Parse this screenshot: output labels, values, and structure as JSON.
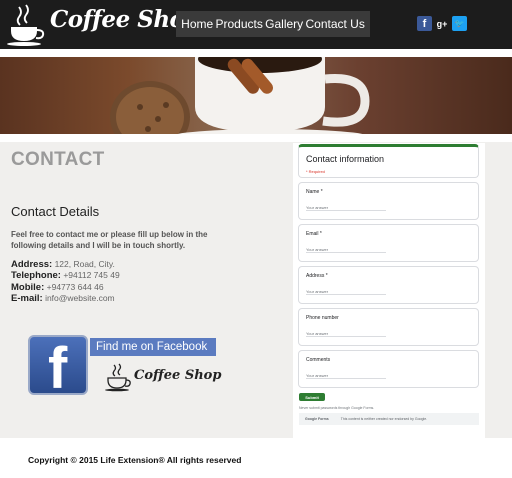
{
  "brand": {
    "name": "Coffee Shop"
  },
  "nav": {
    "home": "Home",
    "products": "Products",
    "gallery": "Gallery",
    "contact": "Contact Us"
  },
  "social": {
    "facebook_icon": "facebook-icon",
    "facebook_glyph": "f",
    "googleplus_icon": "googleplus-icon",
    "googleplus_glyph": "g+",
    "twitter_icon": "twitter-icon",
    "twitter_glyph": "🐦"
  },
  "page": {
    "title": "CONTACT",
    "details_heading": "Contact Details",
    "intro": "Feel free to contact me or please fill up below in the following details and I will be in touch shortly.",
    "address_label": "Address:",
    "address_value": "122, Road, City.",
    "telephone_label": "Telephone:",
    "telephone_value": "+94112 745 49",
    "mobile_label": "Mobile:",
    "mobile_value": "+94773 644 46",
    "email_label": "E-mail:",
    "email_value": "info@website.com",
    "facebook_banner": "Find me on Facebook",
    "facebook_glyph": "f",
    "footer_brand": "Coffee Shop"
  },
  "form": {
    "title": "Contact information",
    "required_note": "* Required",
    "fields": [
      {
        "label": "Name *",
        "placeholder": "Your answer"
      },
      {
        "label": "Email *",
        "placeholder": "Your answer"
      },
      {
        "label": "Address *",
        "placeholder": "Your answer"
      },
      {
        "label": "Phone number",
        "placeholder": "Your answer"
      },
      {
        "label": "Comments",
        "placeholder": "Your answer"
      }
    ],
    "submit": "Submit",
    "never_submit": "Never submit passwords through Google Forms.",
    "footer_brand": "Google Forms",
    "footer_note": "This content is neither created nor endorsed by Google."
  },
  "footer": {
    "copyright": "Copyright © 2015 Life Extension® All rights reserved"
  },
  "colors": {
    "header_bg": "#1c1c1c",
    "nav_bg": "#3a3a3a",
    "facebook_blue": "#3b5998",
    "twitter_blue": "#1da1f2",
    "form_accent": "#2e7d32",
    "required_red": "#d93025"
  }
}
